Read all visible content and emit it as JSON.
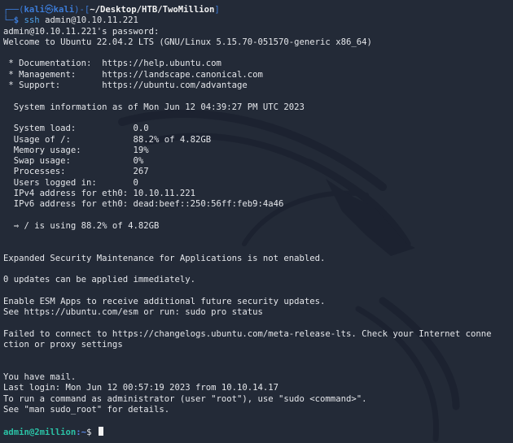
{
  "prompt_local": {
    "user": "kali",
    "separator_icon": "skull-icon",
    "host": "kali",
    "cwd": "~/Desktop/HTB/TwoMillion",
    "command_name": "ssh",
    "command_args": "admin@10.10.11.221"
  },
  "output": {
    "password_prompt": "admin@10.10.11.221's password:",
    "welcome": "Welcome to Ubuntu 22.04.2 LTS (GNU/Linux 5.15.70-051570-generic x86_64)",
    "links": [
      {
        "label": " * Documentation:  ",
        "url": "https://help.ubuntu.com"
      },
      {
        "label": " * Management:     ",
        "url": "https://landscape.canonical.com"
      },
      {
        "label": " * Support:        ",
        "url": "https://ubuntu.com/advantage"
      }
    ],
    "sysinfo_header": "  System information as of Mon Jun 12 04:39:27 PM UTC 2023",
    "sysinfo": [
      {
        "key": "  System load:           ",
        "value": "0.0"
      },
      {
        "key": "  Usage of /:            ",
        "value": "88.2% of 4.82GB"
      },
      {
        "key": "  Memory usage:          ",
        "value": "19%"
      },
      {
        "key": "  Swap usage:            ",
        "value": "0%"
      },
      {
        "key": "  Processes:             ",
        "value": "267"
      },
      {
        "key": "  Users logged in:       ",
        "value": "0"
      },
      {
        "key": "  IPv4 address for eth0: ",
        "value": "10.10.11.221"
      },
      {
        "key": "  IPv6 address for eth0: ",
        "value": "dead:beef::250:56ff:feb9:4a46"
      }
    ],
    "disk_warning": "  ⇒ / is using 88.2% of 4.82GB",
    "esm_status": "Expanded Security Maintenance for Applications is not enabled.",
    "updates": "0 updates can be applied immediately.",
    "esm_enable_1": "Enable ESM Apps to receive additional future security updates.",
    "esm_enable_2": "See https://ubuntu.com/esm or run: sudo pro status",
    "failed_connect_1": "Failed to connect to https://changelogs.ubuntu.com/meta-release-lts. Check your Internet conne",
    "failed_connect_2": "ction or proxy settings",
    "mail": "You have mail.",
    "last_login": "Last login: Mon Jun 12 00:57:19 2023 from 10.10.14.17",
    "sudo_hint_1": "To run a command as administrator (user \"root\"), use \"sudo <command>\".",
    "sudo_hint_2": "See \"man sudo_root\" for details."
  },
  "prompt_remote": {
    "user_host": "admin@2million",
    "colon": ":",
    "path": "~",
    "symbol": "$ "
  },
  "colors": {
    "background": "#232a37",
    "kali_blue": "#3c7bd6",
    "remote_prompt_green": "#2bc2a6",
    "text": "#e4e6ea"
  }
}
